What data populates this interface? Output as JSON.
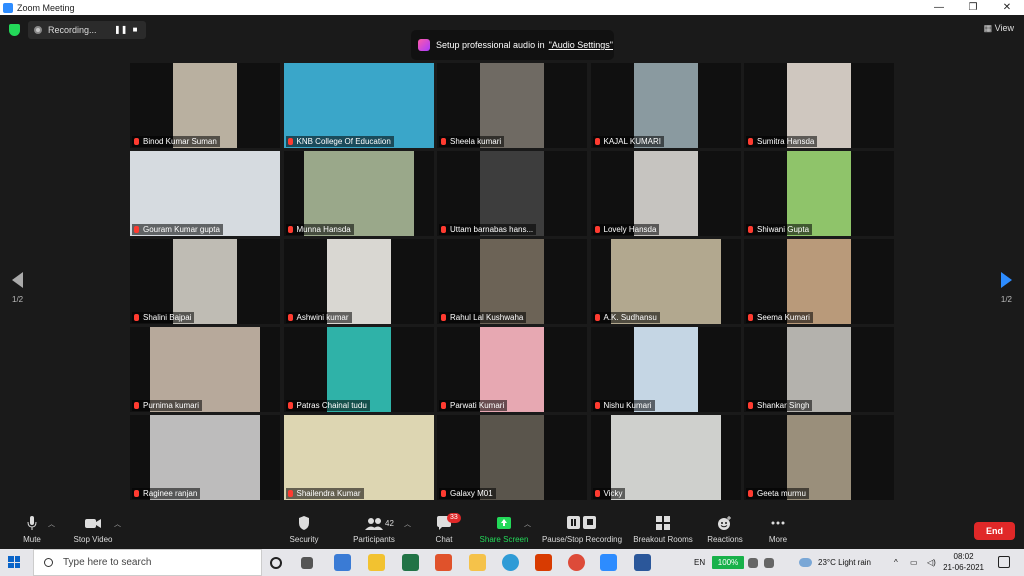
{
  "window": {
    "title": "Zoom Meeting",
    "minimize": "—",
    "maximize": "❐",
    "close": "✕"
  },
  "topbar": {
    "recording_label": "Recording...",
    "view_label": "View",
    "banner_text": "Setup professional audio in",
    "banner_link": "\"Audio Settings\""
  },
  "gallery": {
    "page_indicator_left": "1/2",
    "page_indicator_right": "1/2",
    "participants": [
      {
        "name": "Binod Kumar Suman",
        "color": "#b9b0a0"
      },
      {
        "name": "KNB College Of Education",
        "color": "#3aa6c9"
      },
      {
        "name": "Sheela kumari",
        "color": "#6f6a63"
      },
      {
        "name": "KAJAL KUMARI",
        "color": "#8a9aa0"
      },
      {
        "name": "Sumitra Hansda",
        "color": "#cfc7bf"
      },
      {
        "name": "Gouram Kumar gupta",
        "color": "#d6dbe0"
      },
      {
        "name": "Munna Hansda",
        "color": "#9aa88a"
      },
      {
        "name": "Uttam barnabas hans...",
        "color": "#3d3d3d"
      },
      {
        "name": "Lovely Hansda",
        "color": "#c6c4c0"
      },
      {
        "name": "Shiwani Gupta",
        "color": "#8fc46a"
      },
      {
        "name": "Shalini Bajpai",
        "color": "#bfbcb4"
      },
      {
        "name": "Ashwini kumar",
        "color": "#d9d7d2"
      },
      {
        "name": "Rahul Lal Kushwaha",
        "color": "#6c6356"
      },
      {
        "name": "A.K. Sudhansu",
        "color": "#b2a88f"
      },
      {
        "name": "Seema Kumari",
        "color": "#b99a7a"
      },
      {
        "name": "Purnima kumari",
        "color": "#b7a99b"
      },
      {
        "name": "Patras Chainal tudu",
        "color": "#2fb2a8"
      },
      {
        "name": "Parwati Kumari",
        "color": "#e7a8b2"
      },
      {
        "name": "Nishu Kumari",
        "color": "#c5d6e4"
      },
      {
        "name": "Shankar Singh",
        "color": "#b4b2ad"
      },
      {
        "name": "Raginee ranjan",
        "color": "#bdbcbc"
      },
      {
        "name": "Shailendra Kumar",
        "color": "#ddd6b2"
      },
      {
        "name": "Galaxy M01",
        "color": "#5a554c"
      },
      {
        "name": "Vicky",
        "color": "#cfd0cd"
      },
      {
        "name": "Geeta murmu",
        "color": "#9a8f7b"
      }
    ]
  },
  "toolbar": {
    "mute": "Mute",
    "stop_video": "Stop Video",
    "security": "Security",
    "participants": "Participants",
    "participants_count": "42",
    "chat": "Chat",
    "chat_badge": "33",
    "share_screen": "Share Screen",
    "pause_stop_recording": "Pause/Stop Recording",
    "breakout_rooms": "Breakout Rooms",
    "reactions": "Reactions",
    "more": "More",
    "end": "End"
  },
  "taskbar": {
    "search_placeholder": "Type here to search",
    "language": "EN",
    "battery": "100%",
    "weather": "23°C  Light rain",
    "time": "08:02",
    "date": "21-06-2021"
  },
  "colors": {
    "accent": "#2d8cff",
    "active_speaker": "#d7f24b",
    "end_red": "#e02828",
    "share_green": "#23d959"
  }
}
